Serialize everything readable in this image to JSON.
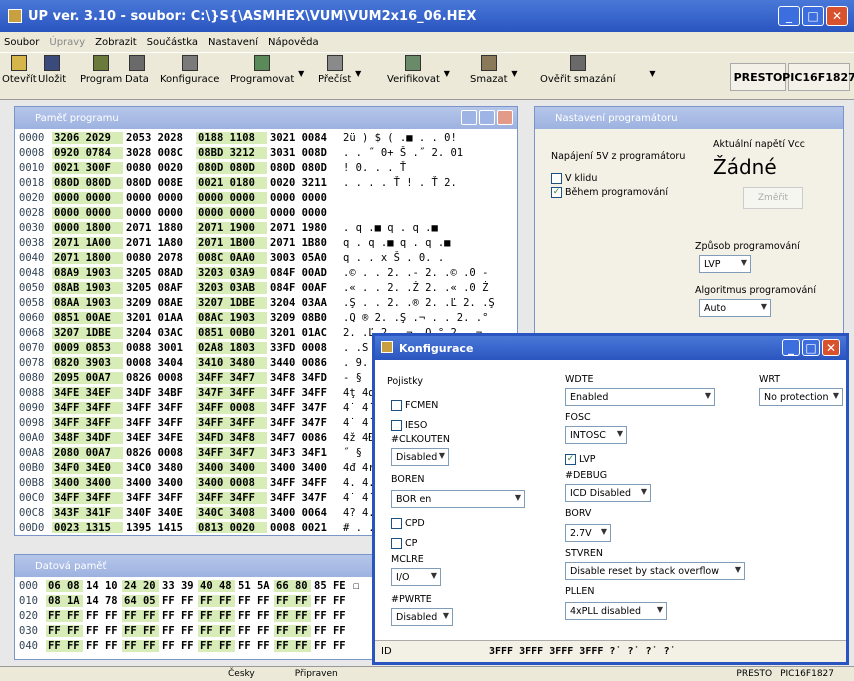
{
  "window": {
    "title": "UP ver. 3.10 - soubor: C:\\}S{\\ASMHEX\\VUM\\VUM2x16_06.HEX"
  },
  "menu": [
    "Soubor",
    "Úpravy",
    "Zobrazit",
    "Součástka",
    "Nastavení",
    "Nápověda"
  ],
  "toolbar": {
    "otevrit": "Otevřít",
    "ulozit": "Uložit",
    "program": "Program",
    "data": "Data",
    "konfigurace": "Konfigurace",
    "programovat": "Programovat",
    "precist": "Přečíst",
    "verifikovat": "Verifikovat",
    "smazat": "Smazat",
    "overit": "Ověřit smazání",
    "presto": "PRESTO",
    "device": "PIC16F1827"
  },
  "program_window": {
    "title": "Paměť programu",
    "rows": [
      {
        "a": "0000",
        "c": [
          "3206 2029",
          "2053 2028",
          "0188 1108",
          "3021 0084"
        ],
        "t": "2ü ) $ ( .■ . . 0!"
      },
      {
        "a": "0008",
        "c": [
          "0920 0784",
          "3028 008C",
          "08BD 3212",
          "3031 008D"
        ],
        "t": ". . ˝ 0+ Š .˝ 2. 01"
      },
      {
        "a": "0010",
        "c": [
          "0021 300F",
          "0080 0020",
          "080D 080D",
          "080D 080D"
        ],
        "t": "! 0. . . Ť"
      },
      {
        "a": "0018",
        "c": [
          "080D 080D",
          "080D 008E",
          "0021 0180",
          "0020 3211"
        ],
        "t": ". . . . Ť ! . Ť 2."
      },
      {
        "a": "0020",
        "c": [
          "0000 0000",
          "0000 0000",
          "0000 0000",
          "0000 0000"
        ],
        "t": ""
      },
      {
        "a": "0028",
        "c": [
          "0000 0000",
          "0000 0000",
          "0000 0000",
          "0000 0000"
        ],
        "t": ""
      },
      {
        "a": "0030",
        "c": [
          "0000 1800",
          "2071 1880",
          "2071 1900",
          "2071 1980"
        ],
        "t": ". q .■ q . q .■"
      },
      {
        "a": "0038",
        "c": [
          "2071 1A00",
          "2071 1A80",
          "2071 1B00",
          "2071 1B80"
        ],
        "t": "q . q .■ q . q .■"
      },
      {
        "a": "0040",
        "c": [
          "2071 1800",
          "0080 2078",
          "008C 0AA0",
          "3003 05A0"
        ],
        "t": "q . . x Š . 0. ."
      },
      {
        "a": "0048",
        "c": [
          "08A9 1903",
          "3205 08AD",
          "3203 03A9",
          "084F 00AD"
        ],
        "t": ".© . . 2. .- 2. .© .0 -"
      },
      {
        "a": "0050",
        "c": [
          "08AB 1903",
          "3205 08AF",
          "3203 03AB",
          "084F 00AF"
        ],
        "t": ".« . . 2. .Ż 2. .« .0 Ż"
      },
      {
        "a": "0058",
        "c": [
          "08AA 1903",
          "3209 08AE",
          "3207 1DBE",
          "3204 03AA"
        ],
        "t": ".Ş . . 2. .® 2. .Ľ 2. .Ş"
      },
      {
        "a": "0060",
        "c": [
          "0851 00AE",
          "3201 01AA",
          "08AC 1903",
          "3209 08B0"
        ],
        "t": ".Q ® 2. .Ş .¬ . . 2. .°"
      },
      {
        "a": "0068",
        "c": [
          "3207 1DBE",
          "3204 03AC",
          "0851 00B0",
          "3201 01AC"
        ],
        "t": "2. .Ľ 2. .¬ .Q ° 2. .¬"
      },
      {
        "a": "0070",
        "c": [
          "0009 0853",
          "0088 3001",
          "02A8 1803",
          "33FD 0008"
        ],
        "t": ". .S"
      },
      {
        "a": "0078",
        "c": [
          "0820 3903",
          "0008 3404",
          "3410 3480",
          "3440 0086"
        ],
        "t": ". 9."
      },
      {
        "a": "0080",
        "c": [
          "2095 00A7",
          "0826 0008",
          "34FF 34F7",
          "34F8 34FD"
        ],
        "t": "- §"
      },
      {
        "a": "0088",
        "c": [
          "34FE 34EF",
          "34DF 34BF",
          "347F 34FF",
          "34FF 34FF"
        ],
        "t": "4ţ 4ď"
      },
      {
        "a": "0090",
        "c": [
          "34FF 34FF",
          "34FF 34FF",
          "34FF 0008",
          "34FF 347F"
        ],
        "t": "4˙ 4˙"
      },
      {
        "a": "0098",
        "c": [
          "34FF 34FF",
          "34FF 34FF",
          "34FF 34FF",
          "34FF 347F"
        ],
        "t": "4˙ 4˙"
      },
      {
        "a": "00A0",
        "c": [
          "348F 34DF",
          "34EF 34FE",
          "34FD 34F8",
          "34F7 0086"
        ],
        "t": "4ž 4Ð"
      },
      {
        "a": "00A8",
        "c": [
          "2080 00A7",
          "0826 0008",
          "34FF 34F7",
          "34F3 34F1"
        ],
        "t": "˝ §"
      },
      {
        "a": "00B0",
        "c": [
          "34F0 34E0",
          "34C0 3480",
          "3400 3400",
          "3400 3400"
        ],
        "t": "4đ 4ŕ"
      },
      {
        "a": "00B8",
        "c": [
          "3400 3400",
          "3400 3400",
          "3400 0008",
          "34FF 34FF"
        ],
        "t": "4. 4."
      },
      {
        "a": "00C0",
        "c": [
          "34FF 34FF",
          "34FF 34FF",
          "34FF 34FF",
          "34FF 347F"
        ],
        "t": "4˙ 4˙"
      },
      {
        "a": "00C8",
        "c": [
          "343F 341F",
          "340F 340E",
          "340C 3408",
          "3400 0064"
        ],
        "t": "4? 4."
      },
      {
        "a": "00D0",
        "c": [
          "0023 1315",
          "1395 1415",
          "0813 0020",
          "0008 0021"
        ],
        "t": "# . ."
      }
    ]
  },
  "data_window": {
    "title": "Datová paměť",
    "rows": [
      {
        "a": "000",
        "c": [
          "06 08",
          "14 10",
          "24 20",
          "33 39",
          "40 48",
          "51 5A",
          "66 80",
          "85 FE"
        ],
        "t": "☐"
      },
      {
        "a": "010",
        "c": [
          "08 1A",
          "14 78",
          "64 05",
          "FF FF",
          "FF FF",
          "FF FF",
          "FF FF",
          "FF FF"
        ],
        "t": ""
      },
      {
        "a": "020",
        "c": [
          "FF FF",
          "FF FF",
          "FF FF",
          "FF FF",
          "FF FF",
          "FF FF",
          "FF FF",
          "FF FF"
        ],
        "t": ""
      },
      {
        "a": "030",
        "c": [
          "FF FF",
          "FF FF",
          "FF FF",
          "FF FF",
          "FF FF",
          "FF FF",
          "FF FF",
          "FF FF"
        ],
        "t": ""
      },
      {
        "a": "040",
        "c": [
          "FF FF",
          "FF FF",
          "FF FF",
          "FF FF",
          "FF FF",
          "FF FF",
          "FF FF",
          "FF FF"
        ],
        "t": ""
      }
    ]
  },
  "nastaveni": {
    "title": "Nastavení programátoru",
    "napajeni": "Napájení 5V z programátoru",
    "v_klidu": "V klidu",
    "behem": "Během programování",
    "aktualni": "Aktuální napětí Vcc",
    "zadne": "Žádné",
    "zmerit": "Změřit",
    "zpusob": "Způsob programování",
    "zpusob_val": "LVP",
    "algoritmus": "Algoritmus programování",
    "algoritmus_val": "Auto"
  },
  "konfigurace": {
    "title": "Konfigurace",
    "pojistky": "Pojistky",
    "fcmen": "FCMEN",
    "ieso": "IESO",
    "clkouten": "#CLKOUTEN",
    "clkouten_val": "Disabled",
    "boren": "BOREN",
    "boren_val": "BOR en",
    "cpd": "CPD",
    "cp": "CP",
    "mclre": "MCLRE",
    "mclre_val": "I/O",
    "pwrte": "#PWRTE",
    "pwrte_val": "Disabled",
    "wdte": "WDTE",
    "wdte_val": "Enabled",
    "fosc": "FOSC",
    "fosc_val": "INTOSC",
    "lvp": "LVP",
    "debug": "#DEBUG",
    "debug_val": "ICD Disabled",
    "borv": "BORV",
    "borv_val": "2.7V",
    "stvren": "STVREN",
    "stvren_val": "Disable reset by stack overflow",
    "pllen": "PLLEN",
    "pllen_val": "4xPLL disabled",
    "wrt": "WRT",
    "wrt_val": "No protection",
    "id_label": "ID",
    "id_values": "3FFF 3FFF 3FFF 3FFF ?˙ ?˙ ?˙ ?˙"
  },
  "status": {
    "lang": "Česky",
    "state": "Připraven",
    "prog": "PRESTO",
    "dev": "PIC16F1827"
  }
}
